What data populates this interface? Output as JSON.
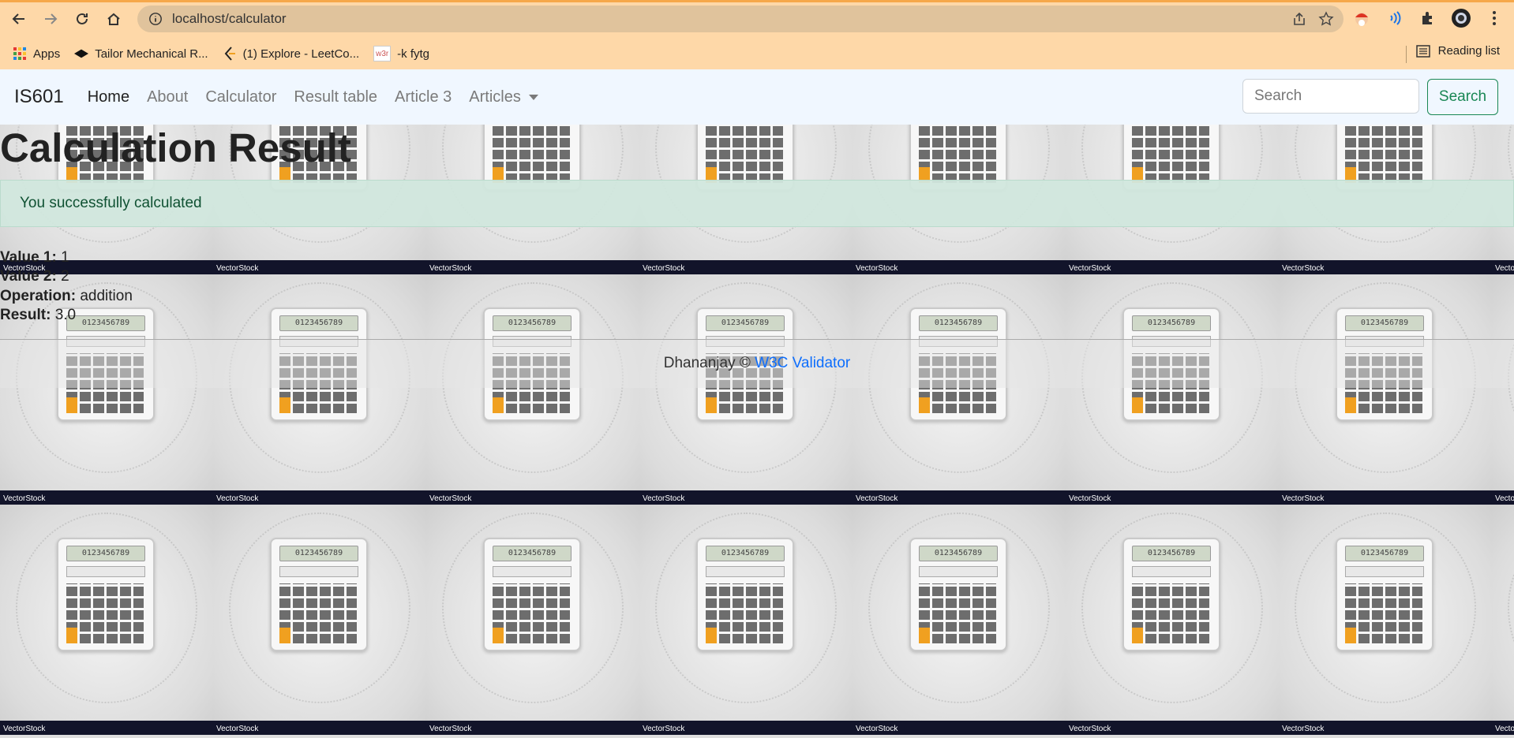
{
  "browser": {
    "url": "localhost/calculator",
    "bookmarks": [
      {
        "label": "Apps",
        "icon": "apps-grid-icon"
      },
      {
        "label": "Tailor Mechanical R...",
        "icon": "diamond-logo-icon"
      },
      {
        "label": "(1) Explore - LeetCo...",
        "icon": "leetcode-icon"
      },
      {
        "label": "-k fytg",
        "icon": "w3-icon",
        "icon_text": "w3r"
      }
    ],
    "reading_list": "Reading list"
  },
  "navbar": {
    "brand": "IS601",
    "links": [
      {
        "label": "Home",
        "active": true
      },
      {
        "label": "About",
        "active": false
      },
      {
        "label": "Calculator",
        "active": false
      },
      {
        "label": "Result table",
        "active": false
      },
      {
        "label": "Article 3",
        "active": false
      },
      {
        "label": "Articles",
        "active": false,
        "dropdown": true
      }
    ],
    "search_placeholder": "Search",
    "search_button": "Search"
  },
  "main": {
    "title": "Calculation Result",
    "alert": "You successfully calculated",
    "fields": [
      {
        "label": "Value 1:",
        "value": "1"
      },
      {
        "label": "Value 2:",
        "value": "2"
      },
      {
        "label": "Operation:",
        "value": "addition"
      },
      {
        "label": "Result:",
        "value": "3.0"
      }
    ]
  },
  "background": {
    "calc_display": "0123456789",
    "watermark": "VectorStock"
  },
  "footer": {
    "author": "Dhananjay ©",
    "link": "W3C Validator"
  },
  "colors": {
    "chrome_bg": "#fed8a8",
    "navbar_bg": "#f0f7ff",
    "alert_bg": "#d1e7dd",
    "alert_text": "#0f5132",
    "search_button": "#198754",
    "link": "#0d6efd"
  }
}
